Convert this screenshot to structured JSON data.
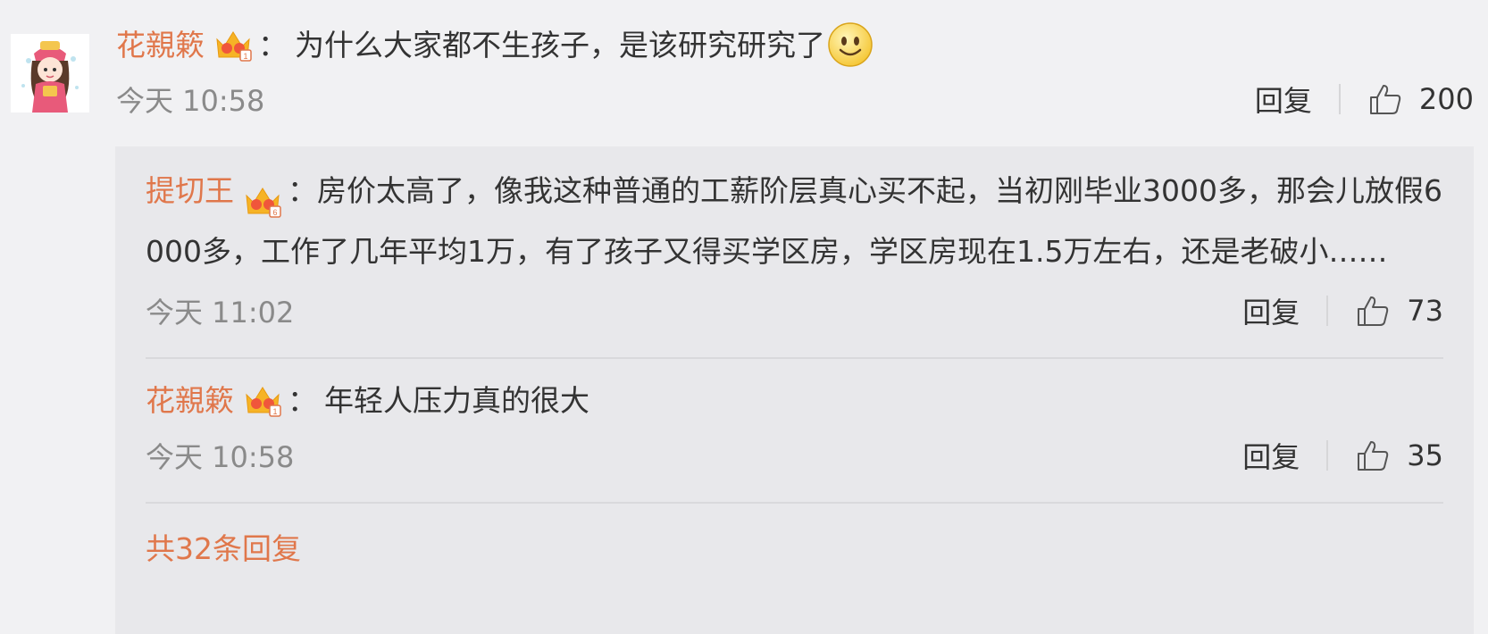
{
  "main_comment": {
    "username": "花親簌",
    "separator": "：",
    "text": "为什么大家都不生孩子，是该研究研究了",
    "emoji": "smile-emoji",
    "time": "今天 10:58",
    "reply_label": "回复",
    "likes": "200"
  },
  "replies": [
    {
      "username": "提切王",
      "separator": "：",
      "text": "房价太高了，像我这种普通的工薪阶层真心买不起，当初刚毕业3000多，那会儿放假6000多，工作了几年平均1万，有了孩子又得买学区房，学区房现在1.5万左右，还是老破小……",
      "time": "今天 11:02",
      "reply_label": "回复",
      "likes": "73"
    },
    {
      "username": "花親簌",
      "separator": "：",
      "text": "年轻人压力真的很大",
      "time": "今天 10:58",
      "reply_label": "回复",
      "likes": "35"
    }
  ],
  "reply_count_text": "共32条回复",
  "colors": {
    "username": "#e0774b",
    "background": "#f1f1f3",
    "reply_panel": "#e8e8eb",
    "timestamp": "#8a8a8a",
    "text": "#333333"
  }
}
